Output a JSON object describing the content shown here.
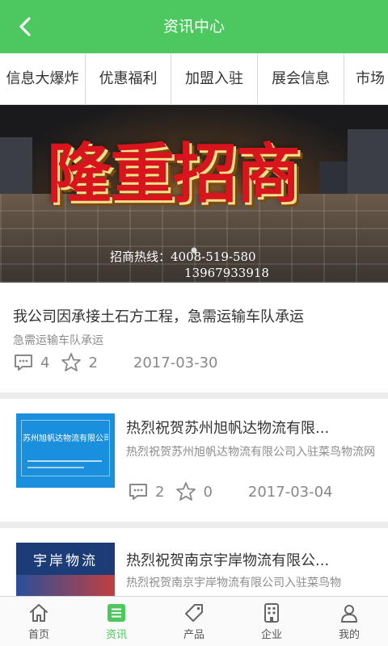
{
  "header": {
    "title": "资讯中心"
  },
  "tabs": [
    "信息大爆炸",
    "优惠福利",
    "加盟入驻",
    "展会信息",
    "市场"
  ],
  "banner": {
    "headline": "隆重招商",
    "hotline_label": "招商热线：4008-519-580",
    "hotline_2": "13967933918"
  },
  "articles": [
    {
      "title": "我公司因承接土石方工程，急需运输车队承运",
      "desc": "急需运输车队承运",
      "comments": "4",
      "favorites": "2",
      "date": "2017-03-30"
    },
    {
      "title": "热烈祝贺苏州旭帆达物流有限...",
      "desc": "热烈祝贺苏州旭帆达物流有限公司入驻菜鸟物流网",
      "comments": "2",
      "favorites": "0",
      "date": "2017-03-04",
      "thumb_text": "苏州旭帆达物流有限公司"
    },
    {
      "title": "热烈祝贺南京宇岸物流有限公...",
      "desc": "热烈祝贺南京宇岸物流有限公司入驻菜鸟物",
      "thumb_text": "宇岸物流"
    }
  ],
  "bottom_nav": [
    {
      "label": "首页",
      "icon": "home-icon"
    },
    {
      "label": "资讯",
      "icon": "list-icon"
    },
    {
      "label": "产品",
      "icon": "tag-icon"
    },
    {
      "label": "企业",
      "icon": "building-icon"
    },
    {
      "label": "我的",
      "icon": "user-icon"
    }
  ],
  "colors": {
    "accent": "#4cc85e",
    "headline_red": "#d8141c"
  }
}
